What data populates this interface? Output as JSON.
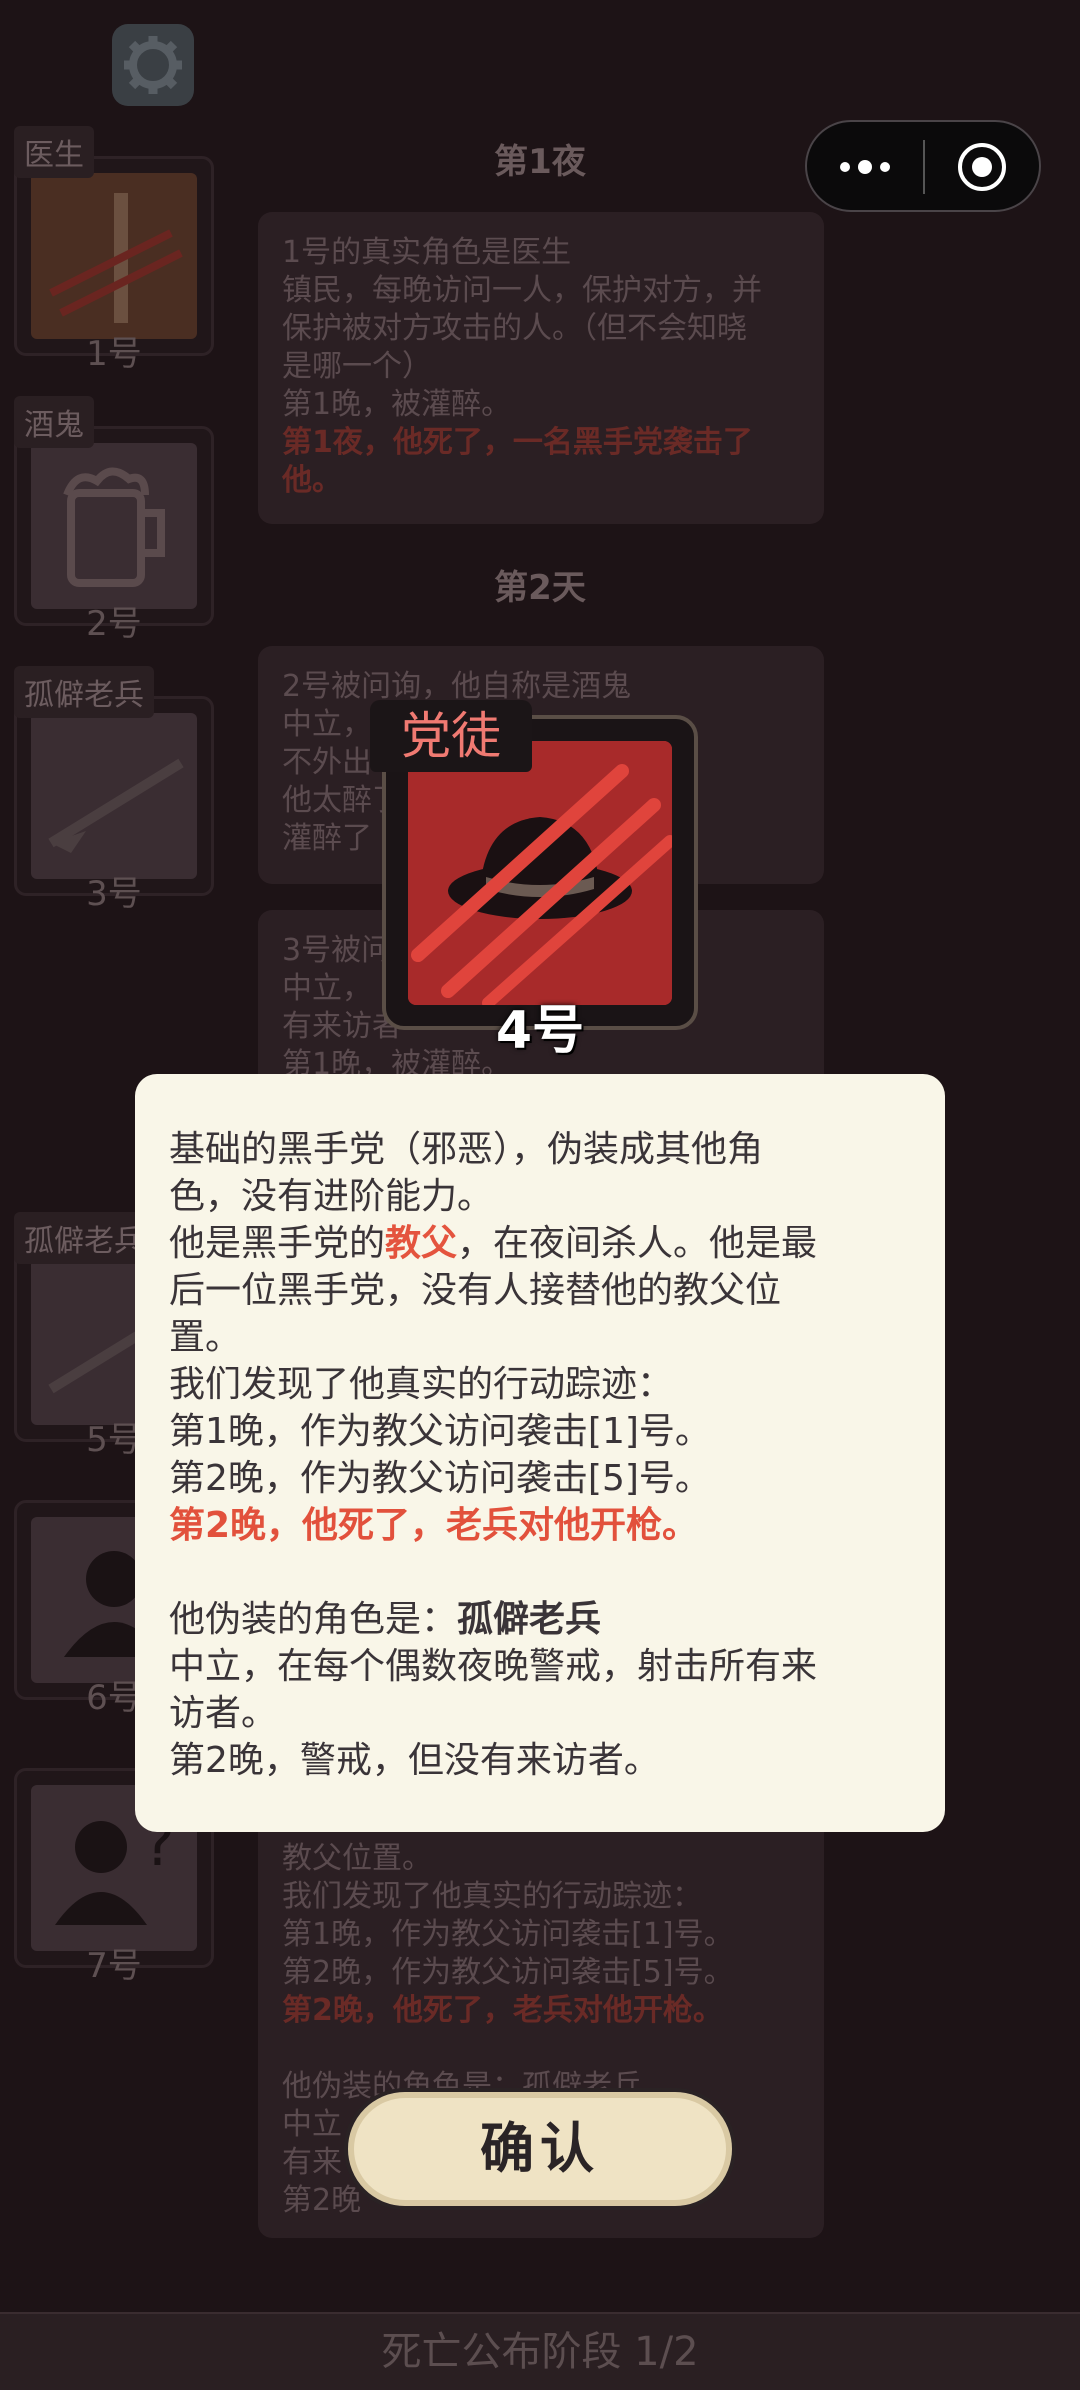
{
  "background": {
    "day1_title": "第1夜",
    "day2_title": "第2天",
    "phase_bar": "死亡公布阶段 1/2",
    "players": [
      {
        "role": "医生",
        "number": "1号"
      },
      {
        "role": "酒鬼",
        "number": "2号"
      },
      {
        "role": "孤僻老兵",
        "number": "3号"
      },
      {
        "role": "孤僻老兵",
        "number": "5号"
      },
      {
        "role": "",
        "number": "6号"
      },
      {
        "role": "",
        "number": "7号"
      }
    ],
    "logs": [
      {
        "lines": [
          "1号的真实角色是医生",
          "镇民，每晚访问一人，保护对方，并",
          "保护被对方攻击的人。（但不会知晓",
          "是哪一个）",
          "第1晚，被灌醉。"
        ],
        "red_lines": [
          "第1夜，他死了，一名黑手党袭击了",
          "他。"
        ]
      },
      {
        "lines": [
          "2号被问询，他自称是酒鬼",
          "中立，",
          "不外出",
          "他太醉了",
          "灌醉了"
        ],
        "red_lines": []
      },
      {
        "lines": [
          "3号被问",
          "中立，",
          "有来访者",
          "第1晚，被灌醉。"
        ],
        "red_lines": []
      },
      {
        "lines": [
          "教父位置。",
          "我们发现了他真实的行动踪迹：",
          "第1晚，作为教父访问袭击[1]号。",
          "第2晚，作为教父访问袭击[5]号。"
        ],
        "red_lines": [
          "第2晚，他死了，老兵对他开枪。"
        ],
        "lines2": [
          "他伪装的角色是：孤僻老兵",
          "中立",
          "有来",
          "第2晚"
        ]
      }
    ]
  },
  "popup": {
    "role_tag": "党徒",
    "player_number": "4号",
    "description": {
      "line1": "基础的黑手党（邪恶），伪装成其他角",
      "line2": "色，没有进阶能力。",
      "line3_pre": "他是黑手党的",
      "line3_hl": "教父",
      "line3_post": "，在夜间杀人。他是最",
      "line4": "后一位黑手党，没有人接替他的教父位",
      "line5": "置。",
      "line6": "我们发现了他真实的行动踪迹：",
      "line7": "第1晚，作为教父访问袭击[1]号。",
      "line8": "第2晚，作为教父访问袭击[5]号。",
      "line9_red": "第2晚，他死了，老兵对他开枪。",
      "line10_pre": "他伪装的角色是：",
      "line10_bold": "孤僻老兵",
      "line11": "中立，在每个偶数夜晚警戒，射击所有来",
      "line12": "访者。",
      "line13": "第2晚，警戒，但没有来访者。"
    },
    "confirm_label": "确认"
  },
  "icons": {
    "settings": "gear-icon",
    "more": "more-dots-icon",
    "close_target": "target-circle-icon",
    "role_art": "fedora-hat-claw-icon"
  },
  "colors": {
    "accent_red": "#e2513c",
    "dialog_bg": "#f9f6e8",
    "role_card_red": "#a82a2a"
  }
}
